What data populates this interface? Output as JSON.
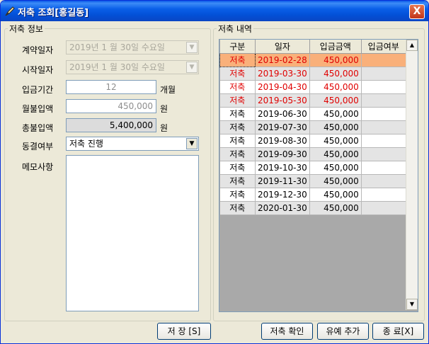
{
  "window": {
    "title": "저축 조회[홍길동]",
    "close_label": "X"
  },
  "info_group": {
    "title": "저축 정보",
    "fields": {
      "contract_date": {
        "label": "계약일자",
        "value": "2019년  1 월 30일 수요일"
      },
      "start_date": {
        "label": "시작일자",
        "value": "2019년  1 월 30일 수요일"
      },
      "period": {
        "label": "입금기간",
        "value": "12",
        "unit": "개월"
      },
      "monthly": {
        "label": "월불입액",
        "value": "450,000",
        "unit": "원"
      },
      "total": {
        "label": "총불입액",
        "value": "5,400,000",
        "unit": "원"
      },
      "freeze": {
        "label": "동결여부",
        "value": "저축 진행"
      },
      "memo": {
        "label": "메모사항",
        "value": ""
      }
    }
  },
  "history_group": {
    "title": "저축 내역",
    "columns": [
      "구분",
      "일자",
      "입금금액",
      "입금여부"
    ],
    "rows": [
      {
        "type": "저축",
        "date": "2019-02-28",
        "amount": "450,000",
        "status": ""
      },
      {
        "type": "저축",
        "date": "2019-03-30",
        "amount": "450,000",
        "status": ""
      },
      {
        "type": "저축",
        "date": "2019-04-30",
        "amount": "450,000",
        "status": ""
      },
      {
        "type": "저축",
        "date": "2019-05-30",
        "amount": "450,000",
        "status": ""
      },
      {
        "type": "저축",
        "date": "2019-06-30",
        "amount": "450,000",
        "status": ""
      },
      {
        "type": "저축",
        "date": "2019-07-30",
        "amount": "450,000",
        "status": ""
      },
      {
        "type": "저축",
        "date": "2019-08-30",
        "amount": "450,000",
        "status": ""
      },
      {
        "type": "저축",
        "date": "2019-09-30",
        "amount": "450,000",
        "status": ""
      },
      {
        "type": "저축",
        "date": "2019-10-30",
        "amount": "450,000",
        "status": ""
      },
      {
        "type": "저축",
        "date": "2019-11-30",
        "amount": "450,000",
        "status": ""
      },
      {
        "type": "저축",
        "date": "2019-12-30",
        "amount": "450,000",
        "status": ""
      },
      {
        "type": "저축",
        "date": "2020-01-30",
        "amount": "450,000",
        "status": ""
      }
    ],
    "highlighted_row": 0,
    "red_rows": 4,
    "colors": {
      "selected": "#f9b07a",
      "past_due_text": "#e00000",
      "alt_row": "#e4e4e4"
    }
  },
  "buttons": {
    "save": "저 장 [S]",
    "confirm": "저축 확인",
    "add_grace": "유예 추가",
    "close": "종 료[X]"
  }
}
